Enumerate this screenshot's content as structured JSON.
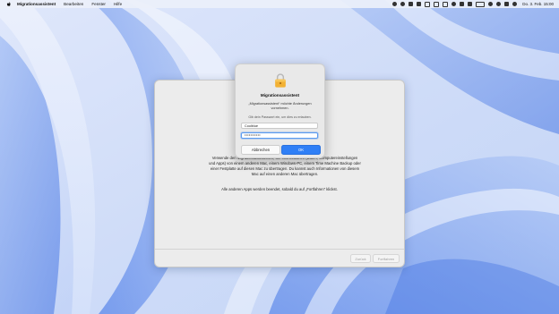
{
  "menubar": {
    "app_name": "Migrationsassistent",
    "items": [
      "Bearbeiten",
      "Fenster",
      "Hilfe"
    ],
    "clock": "Do. 3. Feb. 15:00"
  },
  "window": {
    "description": "Verwende den Migrationsassistenten, um Informationen (Daten, Computereinstellungen und Apps) von einem anderen Mac, einem Windows-PC, einem Time Machine Backup oder einer Festplatte auf diesen Mac zu übertragen. Du kannst auch Informationen von diesem Mac auf einen anderen Mac übertragen.",
    "note": "Alle anderen Apps werden beendet, sobald du auf „Fortfahren“ klickst.",
    "back_button": "Zurück",
    "continue_button": "Fortfahren"
  },
  "dialog": {
    "title": "Migrationsassistent",
    "message": "„Migrationsassistent“ möchte Änderungen vornehmen.",
    "prompt": "Gib dein Passwort ein, um dies zu erlauben.",
    "username": "Coolblue",
    "password_mask": "•••••••••••",
    "cancel_label": "Abbrechen",
    "ok_label": "OK"
  }
}
